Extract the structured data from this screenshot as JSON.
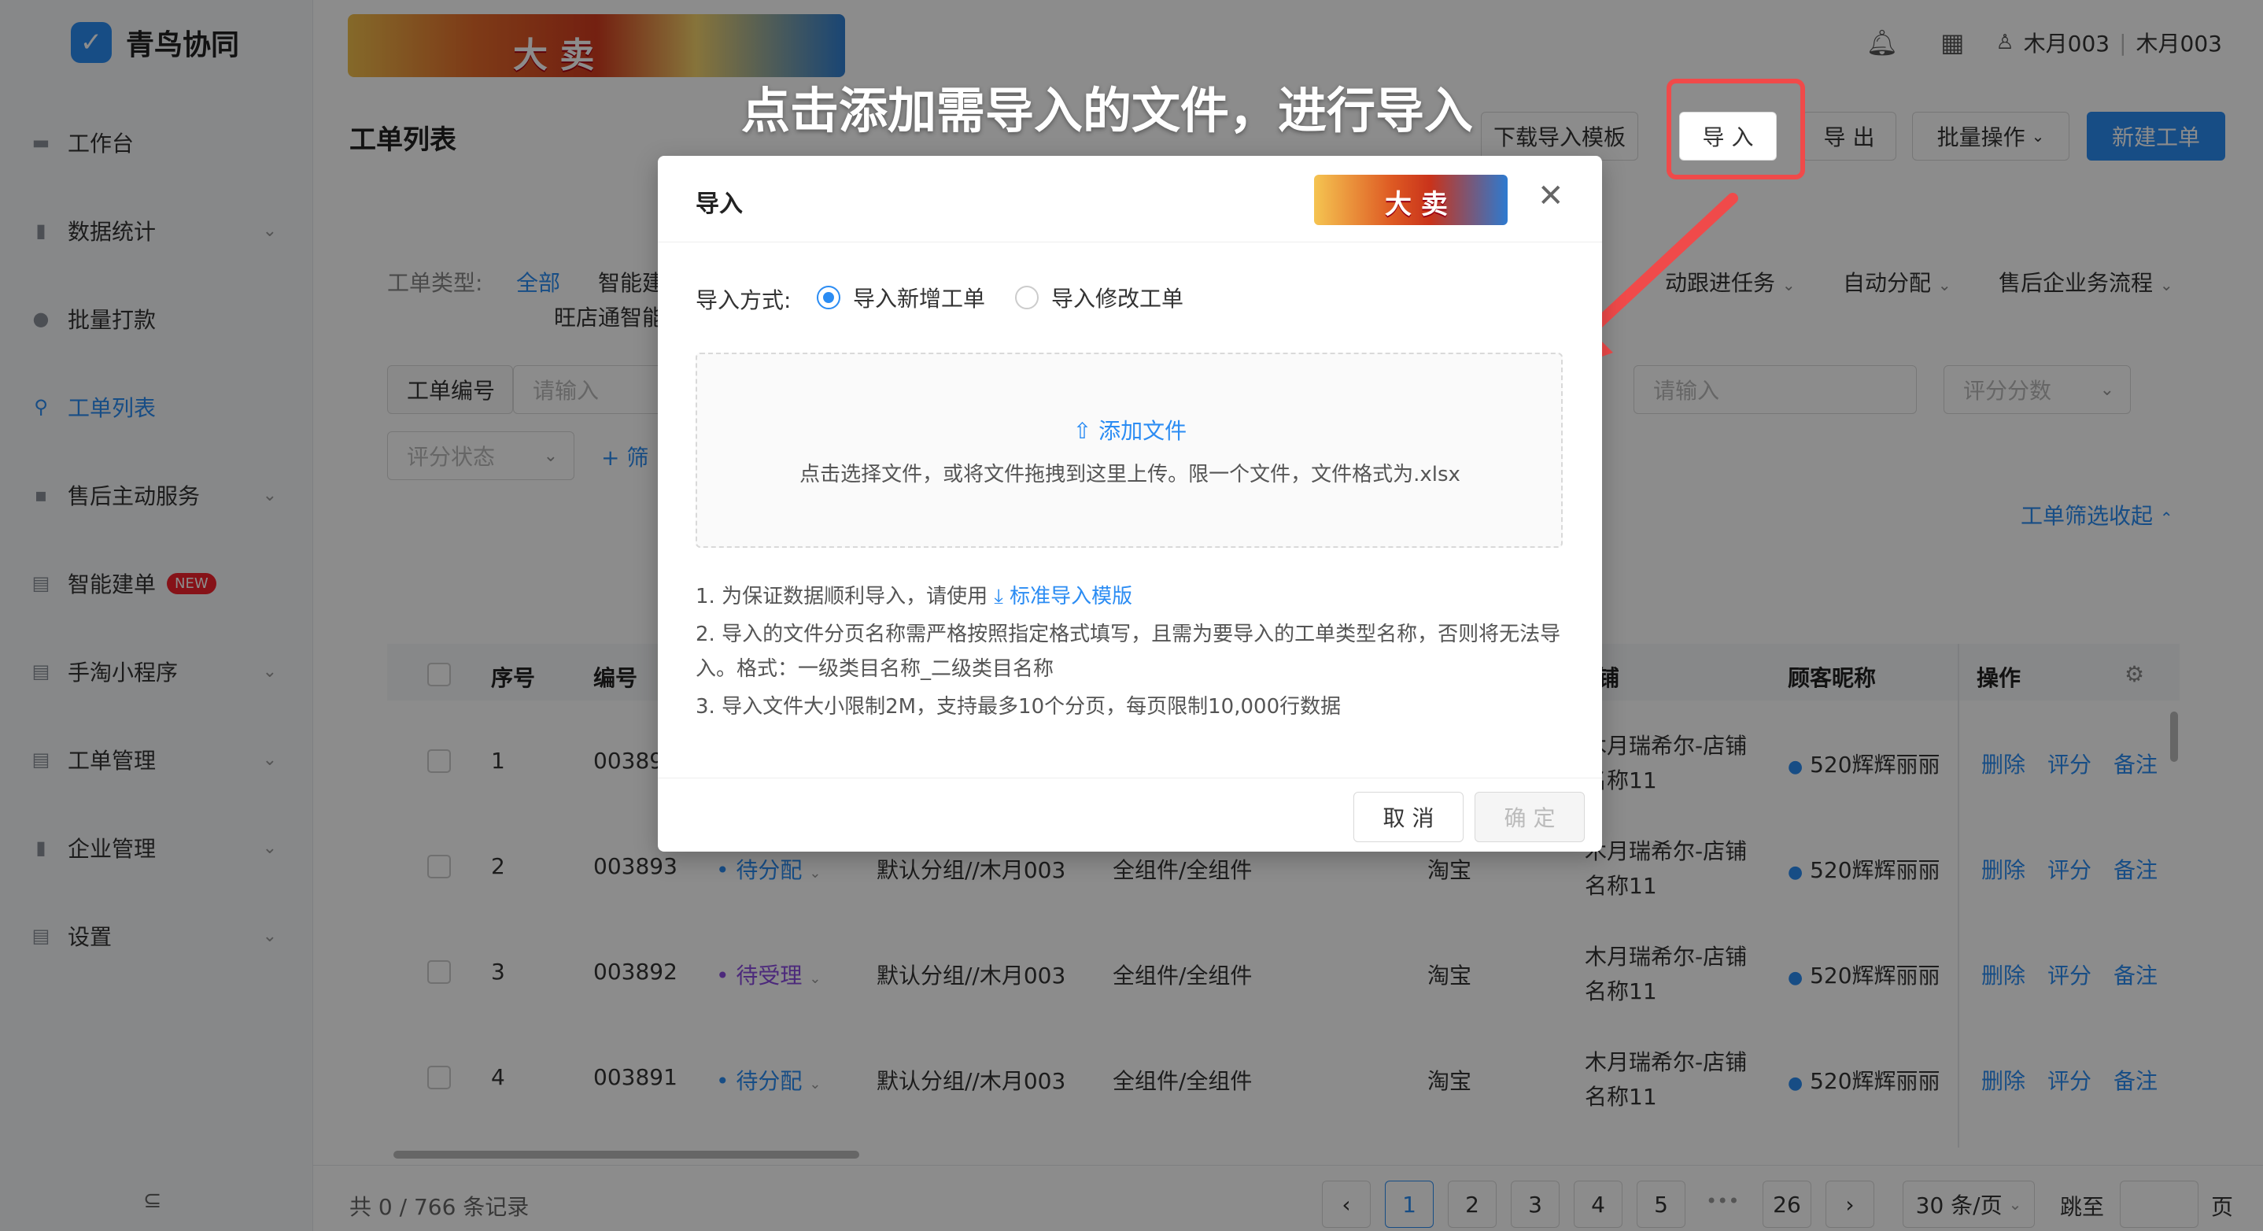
{
  "app": {
    "name": "青鸟协同"
  },
  "sidebar": {
    "items": [
      {
        "label": "工作台",
        "icon": "desk-icon"
      },
      {
        "label": "数据统计",
        "icon": "bar-chart-icon"
      },
      {
        "label": "批量打款",
        "icon": "coin-icon"
      },
      {
        "label": "工单列表",
        "icon": "search-icon"
      },
      {
        "label": "售后主动服务",
        "icon": "chat-icon"
      },
      {
        "label": "智能建单",
        "icon": "doc-icon",
        "badge": "NEW"
      },
      {
        "label": "手淘小程序",
        "icon": "bag-icon"
      },
      {
        "label": "工单管理",
        "icon": "list-icon"
      },
      {
        "label": "企业管理",
        "icon": "building-icon"
      },
      {
        "label": "设置",
        "icon": "settings-icon"
      }
    ],
    "collapse_glyph": "⊆"
  },
  "topbar": {
    "banner_text": "大 卖",
    "user": "木月003",
    "org": "木月003"
  },
  "header": {
    "title": "工单列表",
    "buttons": [
      "下载导入模板",
      "导 入",
      "导 出",
      "批量操作",
      "新建工单"
    ]
  },
  "annotation": {
    "text": "点击添加需导入的文件，进行导入"
  },
  "filters": {
    "type_label": "工单类型:",
    "types": [
      "全部",
      "智能建",
      "旺店通智能"
    ],
    "right_types": [
      "动跟进任务",
      "自动分配",
      "售后企业务流程"
    ],
    "order_no_label": "工单编号",
    "placeholder": "请输入",
    "score_placeholder": "评分分数",
    "rating_status": "评分状态",
    "add_filter": "+ 筛",
    "collapse": "工单筛选收起"
  },
  "table": {
    "headers": [
      "序号",
      "编号",
      "铺",
      "顾客昵称",
      "操作"
    ],
    "rows": [
      {
        "idx": "1",
        "no": "00389",
        "status": "",
        "group": "",
        "comp": "",
        "platform": "",
        "shop1": "木月瑞希尔-店铺",
        "shop2": "名称11",
        "customer": "520辉辉丽丽"
      },
      {
        "idx": "2",
        "no": "003893",
        "status": "• 待分配",
        "group": "默认分组//木月003",
        "comp": "全组件/全组件",
        "platform": "淘宝",
        "shop1": "木月瑞希尔-店铺",
        "shop2": "名称11",
        "customer": "520辉辉丽丽"
      },
      {
        "idx": "3",
        "no": "003892",
        "status": "• 待受理",
        "group": "默认分组//木月003",
        "comp": "全组件/全组件",
        "platform": "淘宝",
        "shop1": "木月瑞希尔-店铺",
        "shop2": "名称11",
        "customer": "520辉辉丽丽"
      },
      {
        "idx": "4",
        "no": "003891",
        "status": "• 待分配",
        "group": "默认分组//木月003",
        "comp": "全组件/全组件",
        "platform": "淘宝",
        "shop1": "木月瑞希尔-店铺",
        "shop2": "名称11",
        "customer": "520辉辉丽丽"
      }
    ],
    "actions": [
      "删除",
      "评分",
      "备注"
    ]
  },
  "modal": {
    "title": "导入",
    "banner_text": "大 卖",
    "method_label": "导入方式:",
    "options": [
      "导入新增工单",
      "导入修改工单"
    ],
    "selected_option": "导入新增工单",
    "add_file": "添加文件",
    "dropzone_hint": "点击选择文件，或将文件拖拽到这里上传。限一个文件，文件格式为.xlsx",
    "note1": "1. 为保证数据顺利导入，请使用",
    "template_link": "标准导入模版",
    "note2": "2. 导入的文件分页名称需严格按照指定格式填写，且需为要导入的工单类型名称，否则将无法导入。格式：一级类目名称_二级类目名称",
    "note3": "3. 导入文件大小限制2M，支持最多10个分页，每页限制10,000行数据",
    "cancel": "取 消",
    "confirm": "确 定"
  },
  "footer": {
    "records": "共 0 / 766 条记录",
    "pages": [
      "1",
      "2",
      "3",
      "4",
      "5",
      "•••",
      "26"
    ],
    "current_page": "1",
    "page_size": "30 条/页",
    "jump_label": "跳至",
    "page_suffix": "页"
  },
  "colors": {
    "accent": "#2b8cf3",
    "annotation_red": "#f04a4a",
    "danger": "#f5222d",
    "pending_accept": "#8a4be0"
  }
}
